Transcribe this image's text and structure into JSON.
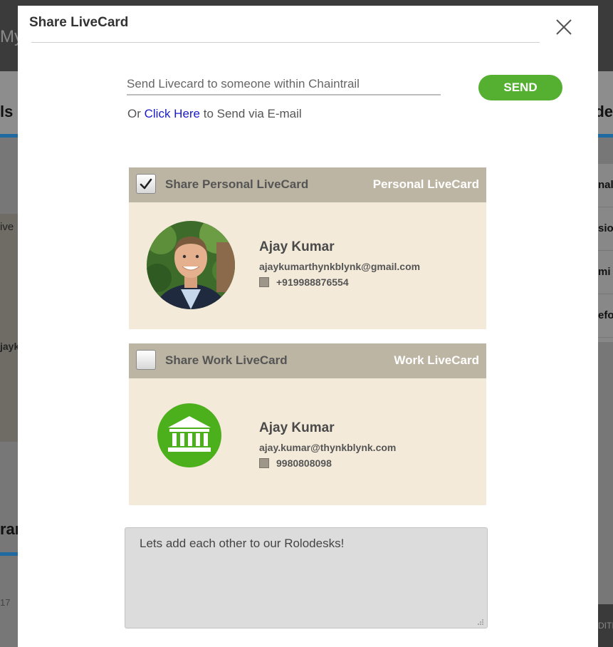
{
  "background": {
    "top_left_text": "My",
    "strip_left_text": "ls",
    "strip_right_text": "de",
    "left_card_text_a": "ive",
    "left_card_text_b": "jayk",
    "right_list": [
      "nal",
      "sio",
      "mi",
      "efo"
    ],
    "left_bottom_text": "ran",
    "left_number": "17",
    "right_footer_text": "DITI"
  },
  "modal": {
    "title": "Share LiveCard",
    "send_placeholder": "Send Livecard to someone within Chaintrail",
    "send_button": "SEND",
    "email_prefix": "Or ",
    "email_link": "Click Here",
    "email_suffix": " to Send via E-mail",
    "message": "Lets add each other to our Rolodesks!"
  },
  "personal_card": {
    "checkbox_label": "Share Personal LiveCard",
    "checked": true,
    "type_label": "Personal LiveCard",
    "name": "Ajay Kumar",
    "email": "ajaykumarthynkblynk@gmail.com",
    "phone": "+919988876554"
  },
  "work_card": {
    "checkbox_label": "Share Work LiveCard",
    "checked": false,
    "type_label": "Work LiveCard",
    "name": "Ajay Kumar",
    "email": "ajay.kumar@thynkblynk.com",
    "phone": "9980808098"
  },
  "colors": {
    "accent_green": "#55b032",
    "card_header": "#bdb5a3",
    "card_body": "#f3eada",
    "link_blue": "#1a1ac8"
  }
}
